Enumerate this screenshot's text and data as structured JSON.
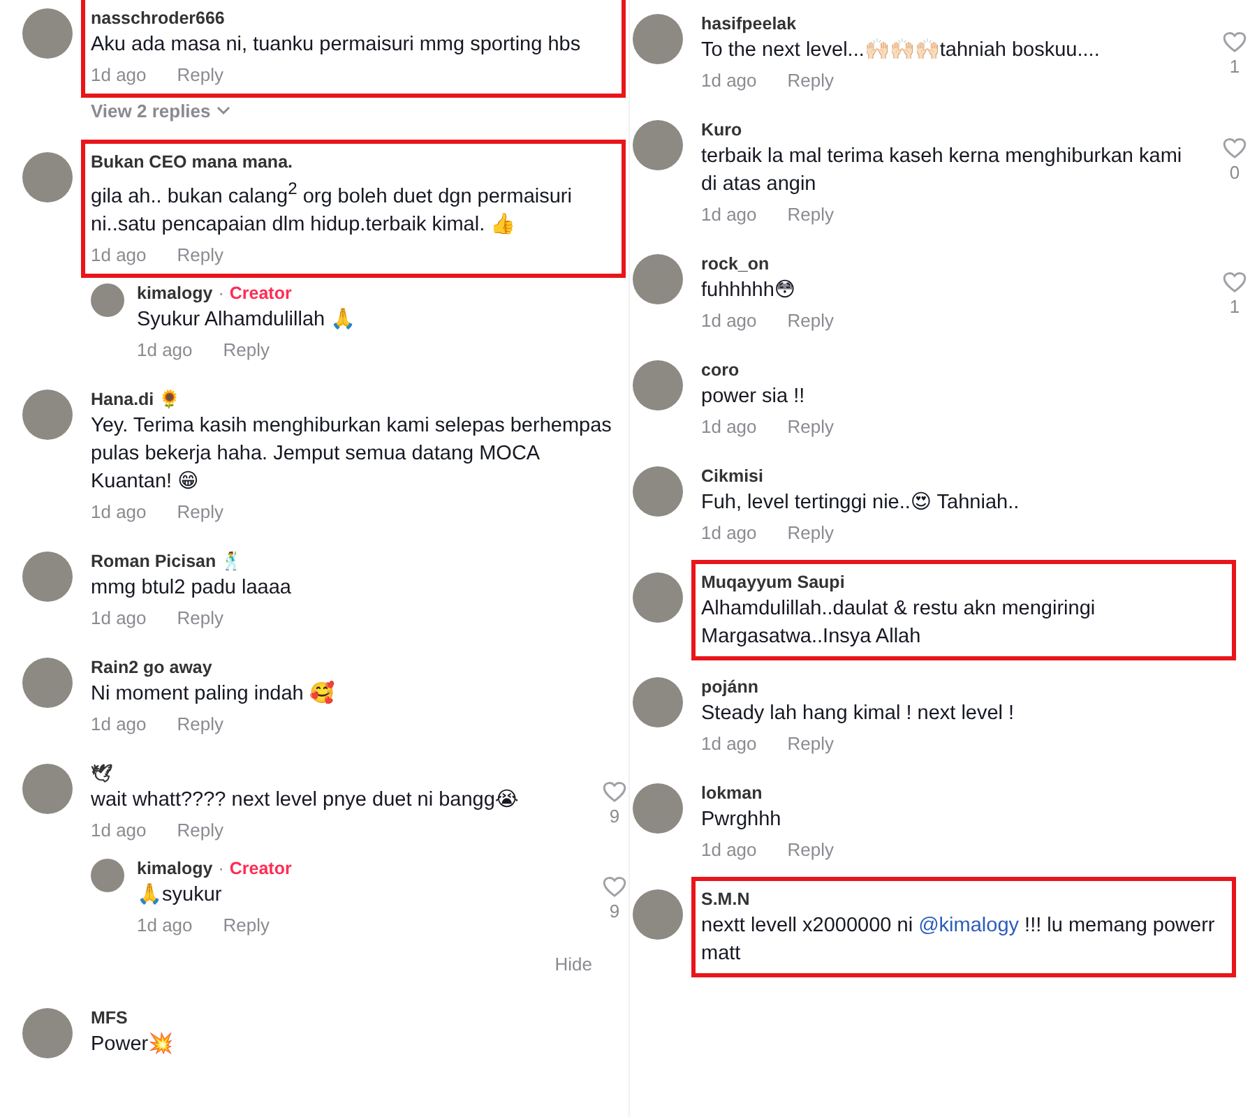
{
  "columns": [
    {
      "items": [
        {
          "kind": "comment",
          "name": "nasschroder666",
          "text": [
            {
              "kind": "plain",
              "text": "Aku ada masa ni, tuanku permaisuri mmg sporting hbs"
            }
          ],
          "time": "1d ago",
          "reply": "Reply",
          "highlighted": true
        },
        {
          "kind": "view_replies",
          "label": "View 2 replies"
        },
        {
          "kind": "comment",
          "name": "Bukan CEO mana mana.",
          "text": [
            {
              "kind": "plain",
              "text": "gila ah.. bukan calang$^{2}$ org boleh duet dgn permaisuri ni..satu pencapaian dlm hidup.terbaik kimal. 👍"
            }
          ],
          "time": "1d ago",
          "reply": "Reply",
          "highlighted": true
        },
        {
          "kind": "reply",
          "name": "kimalogy",
          "separator": "·",
          "badge": "Creator",
          "text": [
            {
              "kind": "plain",
              "text": "Syukur Alhamdulillah 🙏"
            }
          ],
          "time": "1d ago",
          "reply": "Reply",
          "highlighted": false
        },
        {
          "kind": "comment",
          "name": "Hana.di 🌻",
          "text": [
            {
              "kind": "plain",
              "text": "Yey. Terima kasih menghiburkan kami selepas berhempas pulas bekerja haha. Jemput semua datang MOCA Kuantan! 😁"
            }
          ],
          "time": "1d ago",
          "reply": "Reply",
          "highlighted": false
        },
        {
          "kind": "comment",
          "name": "Roman Picisan 🕺",
          "text": [
            {
              "kind": "plain",
              "text": "mmg btul2 padu laaaa"
            }
          ],
          "time": "1d ago",
          "reply": "Reply",
          "highlighted": false
        },
        {
          "kind": "comment",
          "name": "Rain2 go away",
          "text": [
            {
              "kind": "plain",
              "text": "Ni moment paling indah 🥰"
            }
          ],
          "time": "1d ago",
          "reply": "Reply",
          "highlighted": false
        },
        {
          "kind": "comment",
          "name": "🕊",
          "text": [
            {
              "kind": "plain",
              "text": "wait whatt???? next level pnye duet ni bangg😭"
            }
          ],
          "time": "1d ago",
          "reply": "Reply",
          "likes": "9",
          "highlighted": false
        },
        {
          "kind": "reply",
          "name": "kimalogy",
          "separator": "·",
          "badge": "Creator",
          "text": [
            {
              "kind": "plain",
              "text": "🙏syukur"
            }
          ],
          "time": "1d ago",
          "reply": "Reply",
          "likes": "9",
          "highlighted": false
        },
        {
          "kind": "hide",
          "label": "Hide"
        },
        {
          "kind": "comment",
          "name": "MFS",
          "text": [
            {
              "kind": "plain",
              "text": "Power💥"
            }
          ],
          "highlighted": false
        }
      ]
    },
    {
      "items": [
        {
          "kind": "comment",
          "name": "hasifpeelak",
          "text": [
            {
              "kind": "plain",
              "text": "To the next level...🙌🏻🙌🏻🙌🏻tahniah boskuu...."
            }
          ],
          "time": "1d ago",
          "reply": "Reply",
          "likes": "1",
          "highlighted": false
        },
        {
          "kind": "comment",
          "name": "Kuro",
          "text": [
            {
              "kind": "plain",
              "text": "terbaik la mal terima kaseh kerna menghiburkan kami di atas angin"
            }
          ],
          "time": "1d ago",
          "reply": "Reply",
          "likes": "0",
          "highlighted": false
        },
        {
          "kind": "comment",
          "name": "rock_on",
          "text": [
            {
              "kind": "plain",
              "text": "fuhhhhh😳"
            }
          ],
          "time": "1d ago",
          "reply": "Reply",
          "likes": "1",
          "highlighted": false
        },
        {
          "kind": "comment",
          "name": "coro",
          "text": [
            {
              "kind": "plain",
              "text": "power sia !!"
            }
          ],
          "time": "1d ago",
          "reply": "Reply",
          "highlighted": false
        },
        {
          "kind": "comment",
          "name": "Cikmisi",
          "text": [
            {
              "kind": "plain",
              "text": "Fuh, level tertinggi nie..😍 Tahniah.."
            }
          ],
          "time": "1d ago",
          "reply": "Reply",
          "highlighted": false
        },
        {
          "kind": "comment",
          "name": "Muqayyum Saupi",
          "text": [
            {
              "kind": "plain",
              "text": "Alhamdulillah..daulat & restu akn mengiringi Margasatwa..Insya Allah"
            }
          ],
          "highlighted": true
        },
        {
          "kind": "comment",
          "name": "pojánn",
          "text": [
            {
              "kind": "plain",
              "text": "Steady lah hang kimal ! next level !"
            }
          ],
          "time": "1d ago",
          "reply": "Reply",
          "highlighted": false
        },
        {
          "kind": "comment",
          "name": "lokman",
          "text": [
            {
              "kind": "plain",
              "text": "Pwrghhh"
            }
          ],
          "time": "1d ago",
          "reply": "Reply",
          "highlighted": false
        },
        {
          "kind": "comment",
          "name": "S.M.N",
          "text": [
            {
              "kind": "plain",
              "text": "nextt levell x2000000 ni "
            },
            {
              "kind": "mention",
              "text": "@kimalogy"
            },
            {
              "kind": "plain",
              "text": " !!! lu memang powerr matt"
            }
          ],
          "highlighted": true
        }
      ]
    }
  ]
}
